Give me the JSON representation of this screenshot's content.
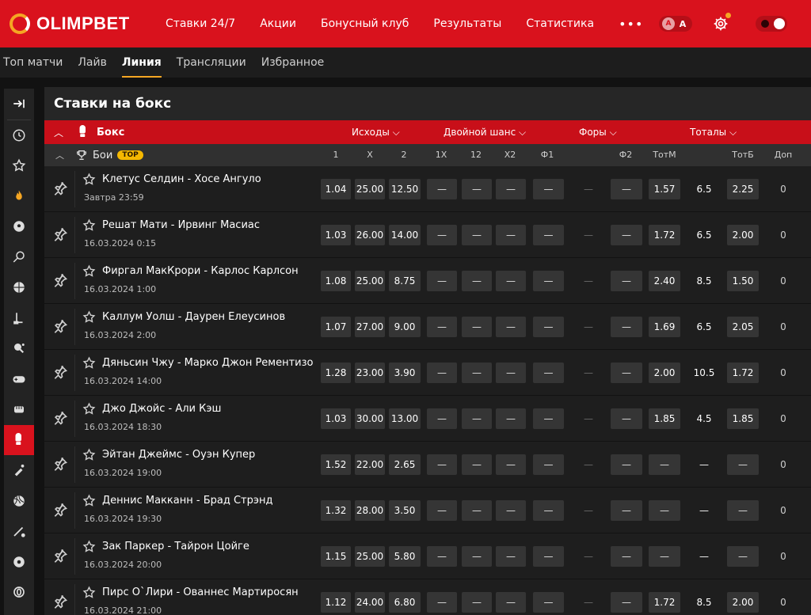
{
  "brand": {
    "name": "OLIMPBET"
  },
  "topnav": [
    "Ставки 24/7",
    "Акции",
    "Бонусный клуб",
    "Результаты",
    "Статистика",
    "•••"
  ],
  "font_toggle": {
    "small": "A",
    "large": "A"
  },
  "subnav": [
    {
      "label": "Топ матчи",
      "active": false
    },
    {
      "label": "Лайв",
      "active": false
    },
    {
      "label": "Линия",
      "active": true
    },
    {
      "label": "Трансляции",
      "active": false
    },
    {
      "label": "Избранное",
      "active": false
    }
  ],
  "sidebar_icons": [
    "collapse-icon",
    "clock-icon",
    "star-icon",
    "fire-icon",
    "football-icon",
    "tennis-icon",
    "basketball-icon",
    "hockey-icon",
    "table-tennis-icon",
    "gamepad-icon",
    "mma-icon",
    "boxing-icon",
    "cricket-icon",
    "volleyball-icon",
    "baseball-icon",
    "football2-icon",
    "esports-icon"
  ],
  "panel_title": "Ставки на бокс",
  "sport": {
    "name": "Бокс",
    "markets": [
      "Исходы",
      "Двойной шанс",
      "Форы",
      "Тоталы"
    ]
  },
  "league": {
    "name": "Бои",
    "badge": "TOP",
    "columns": [
      "1",
      "X",
      "2",
      "1X",
      "12",
      "X2",
      "Ф1",
      "Ф2",
      "ТотМ",
      "ТотБ",
      "Доп"
    ]
  },
  "matches": [
    {
      "name": "Клетус Селдин - Хосе Ангуло",
      "date": "Завтра 23:59",
      "o1": "1.04",
      "ox": "25.00",
      "o2": "12.50",
      "x1": "—",
      "x12": "—",
      "x2": "—",
      "f1": "—",
      "fmid": "—",
      "f2": "—",
      "totm": "1.57",
      "tot": "6.5",
      "totb": "2.25",
      "dop": "0"
    },
    {
      "name": "Решат Мати - Ирвинг Масиас",
      "date": "16.03.2024 0:15",
      "o1": "1.03",
      "ox": "26.00",
      "o2": "14.00",
      "x1": "—",
      "x12": "—",
      "x2": "—",
      "f1": "—",
      "fmid": "—",
      "f2": "—",
      "totm": "1.72",
      "tot": "6.5",
      "totb": "2.00",
      "dop": "0"
    },
    {
      "name": "Фиргал МакКрори - Карлос Карлсон",
      "date": "16.03.2024 1:00",
      "o1": "1.08",
      "ox": "25.00",
      "o2": "8.75",
      "x1": "—",
      "x12": "—",
      "x2": "—",
      "f1": "—",
      "fmid": "—",
      "f2": "—",
      "totm": "2.40",
      "tot": "8.5",
      "totb": "1.50",
      "dop": "0"
    },
    {
      "name": "Каллум Уолш - Даурен Елеусинов",
      "date": "16.03.2024 2:00",
      "o1": "1.07",
      "ox": "27.00",
      "o2": "9.00",
      "x1": "—",
      "x12": "—",
      "x2": "—",
      "f1": "—",
      "fmid": "—",
      "f2": "—",
      "totm": "1.69",
      "tot": "6.5",
      "totb": "2.05",
      "dop": "0"
    },
    {
      "name": "Дяньсин Чжу - Марко Джон Рементизо",
      "date": "16.03.2024 14:00",
      "o1": "1.28",
      "ox": "23.00",
      "o2": "3.90",
      "x1": "—",
      "x12": "—",
      "x2": "—",
      "f1": "—",
      "fmid": "—",
      "f2": "—",
      "totm": "2.00",
      "tot": "10.5",
      "totb": "1.72",
      "dop": "0"
    },
    {
      "name": "Джо Джойс - Али Кэш",
      "date": "16.03.2024 18:30",
      "o1": "1.03",
      "ox": "30.00",
      "o2": "13.00",
      "x1": "—",
      "x12": "—",
      "x2": "—",
      "f1": "—",
      "fmid": "—",
      "f2": "—",
      "totm": "1.85",
      "tot": "4.5",
      "totb": "1.85",
      "dop": "0"
    },
    {
      "name": "Эйтан Джеймс - Оуэн Купер",
      "date": "16.03.2024 19:00",
      "o1": "1.52",
      "ox": "22.00",
      "o2": "2.65",
      "x1": "—",
      "x12": "—",
      "x2": "—",
      "f1": "—",
      "fmid": "—",
      "f2": "—",
      "totm": "—",
      "tot": "—",
      "totb": "—",
      "dop": "0"
    },
    {
      "name": "Деннис Макканн - Брад Стрэнд",
      "date": "16.03.2024 19:30",
      "o1": "1.32",
      "ox": "28.00",
      "o2": "3.50",
      "x1": "—",
      "x12": "—",
      "x2": "—",
      "f1": "—",
      "fmid": "—",
      "f2": "—",
      "totm": "—",
      "tot": "—",
      "totb": "—",
      "dop": "0"
    },
    {
      "name": "Зак Паркер - Тайрон Цойге",
      "date": "16.03.2024 20:00",
      "o1": "1.15",
      "ox": "25.00",
      "o2": "5.80",
      "x1": "—",
      "x12": "—",
      "x2": "—",
      "f1": "—",
      "fmid": "—",
      "f2": "—",
      "totm": "—",
      "tot": "—",
      "totb": "—",
      "dop": "0"
    },
    {
      "name": "Пирс О`Лири - Ованнес Мартиросян",
      "date": "16.03.2024 21:00",
      "o1": "1.12",
      "ox": "24.00",
      "o2": "6.80",
      "x1": "—",
      "x12": "—",
      "x2": "—",
      "f1": "—",
      "fmid": "—",
      "f2": "—",
      "totm": "1.72",
      "tot": "8.5",
      "totb": "2.00",
      "dop": "0"
    }
  ],
  "colors": {
    "brand_red": "#d9121d",
    "accent_yellow": "#f5a623",
    "bg": "#121212",
    "cell_bg": "#353535"
  }
}
